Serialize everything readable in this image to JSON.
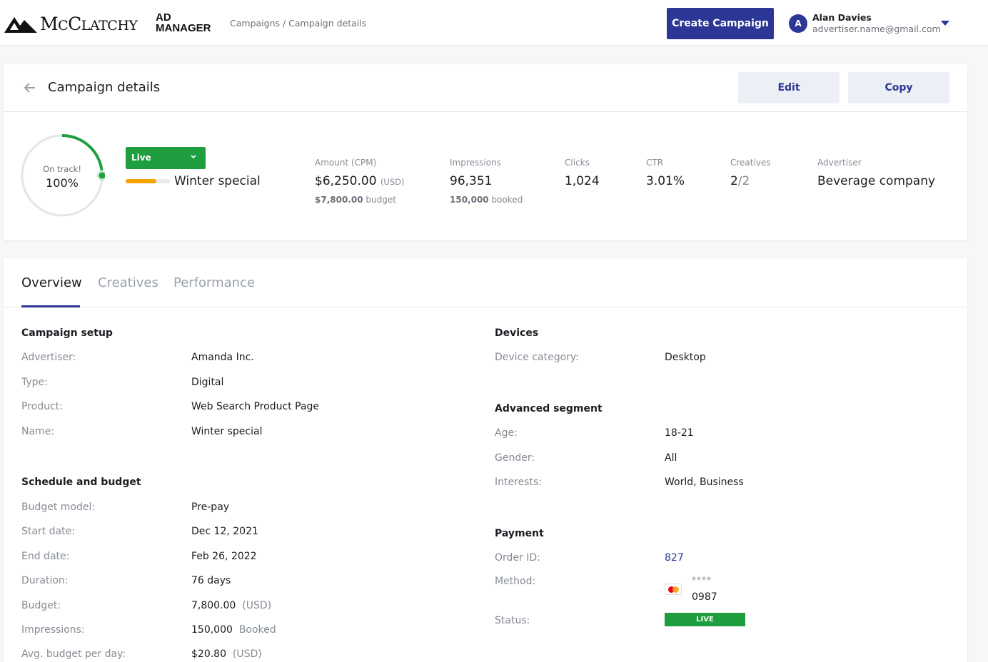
{
  "header": {
    "logo_text": "McClatchy",
    "logo_sub_line1": "AD",
    "logo_sub_line2": "MANAGER",
    "breadcrumb": "Campaigns / Campaign details",
    "create_button": "Create Campaign",
    "user": {
      "initial": "A",
      "name": "Alan Davies",
      "email": "advertiser.name@gmail.com"
    }
  },
  "details": {
    "title": "Campaign details",
    "edit_label": "Edit",
    "copy_label": "Copy",
    "ring": {
      "label": "On track!",
      "value": "100%",
      "progress": 0.25
    },
    "status_select": "Live",
    "campaign_progress": 0.7,
    "campaign_name": "Winter special",
    "stats": {
      "amount": {
        "label": "Amount (CPM)",
        "value": "$6,250.00",
        "unit": "(USD)",
        "sub_value": "$7,800.00",
        "sub_text": "budget"
      },
      "impressions": {
        "label": "Impressions",
        "value": "96,351",
        "sub_value": "150,000",
        "sub_text": "booked"
      },
      "clicks": {
        "label": "Clicks",
        "value": "1,024"
      },
      "ctr": {
        "label": "CTR",
        "value": "3.01%"
      },
      "creatives": {
        "label": "Creatives",
        "value_main": "2",
        "value_rest": "/2"
      },
      "advertiser": {
        "label": "Advertiser",
        "value": "Beverage company"
      }
    }
  },
  "tabs": [
    "Overview",
    "Creatives",
    "Performance"
  ],
  "overview": {
    "campaign_setup": {
      "heading": "Campaign setup",
      "advertiser_label": "Advertiser:",
      "advertiser": "Amanda Inc.",
      "type_label": "Type:",
      "type": "Digital",
      "product_label": "Product:",
      "product": "Web Search Product Page",
      "name_label": "Name:",
      "name": "Winter special"
    },
    "schedule": {
      "heading": "Schedule and budget",
      "budget_model_label": "Budget model:",
      "budget_model": "Pre-pay",
      "start_label": "Start date:",
      "start": "Dec 12, 2021",
      "end_label": "End date:",
      "end": "Feb 26, 2022",
      "duration_label": "Duration:",
      "duration": "76 days",
      "budget_label": "Budget:",
      "budget": "7,800.00",
      "budget_unit": "(USD)",
      "impressions_label": "Impressions:",
      "impressions": "150,000",
      "impressions_unit": "Booked",
      "avg_label": "Avg. budget per day:",
      "avg": "$20.80",
      "avg_unit": "(USD)"
    },
    "devices": {
      "heading": "Devices",
      "category_label": "Device category:",
      "category": "Desktop"
    },
    "segment": {
      "heading": "Advanced segment",
      "age_label": "Age:",
      "age": "18-21",
      "gender_label": "Gender:",
      "gender": "All",
      "interests_label": "Interests:",
      "interests": "World, Business"
    },
    "payment": {
      "heading": "Payment",
      "order_label": "Order ID:",
      "order": "827",
      "method_label": "Method:",
      "card_mask": "****",
      "card_last4": "0987",
      "status_label": "Status:",
      "status": "LIVE"
    }
  },
  "colors": {
    "brand": "#2c3695",
    "live": "#1e9e3e",
    "progress": "#f6a200"
  }
}
